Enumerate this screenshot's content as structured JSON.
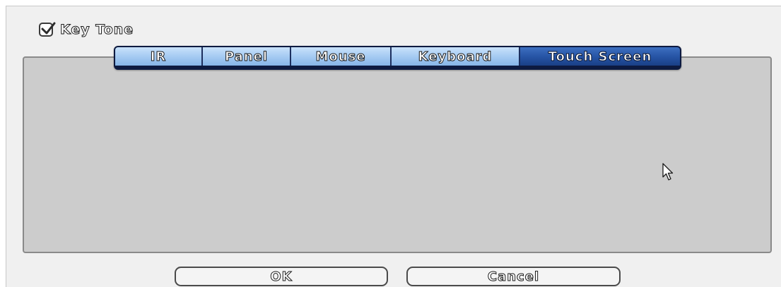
{
  "key_tone": {
    "label": "Key Tone",
    "checked": true
  },
  "tabs": [
    {
      "label": "IR",
      "active": false
    },
    {
      "label": "Panel",
      "active": false
    },
    {
      "label": "Mouse",
      "active": false
    },
    {
      "label": "Keyboard",
      "active": false
    },
    {
      "label": "Touch Screen",
      "active": true
    }
  ],
  "buttons": {
    "ok_label": "OK",
    "cancel_label": "Cancel"
  },
  "colors": {
    "tab_inactive": "#a9cdf3",
    "tab_active": "#2553a3",
    "panel_bg": "#cccccc",
    "dialog_bg": "#f0f0f0"
  },
  "icons": {
    "checkbox": "checkmark-icon",
    "cursor": "mouse-pointer-icon"
  }
}
